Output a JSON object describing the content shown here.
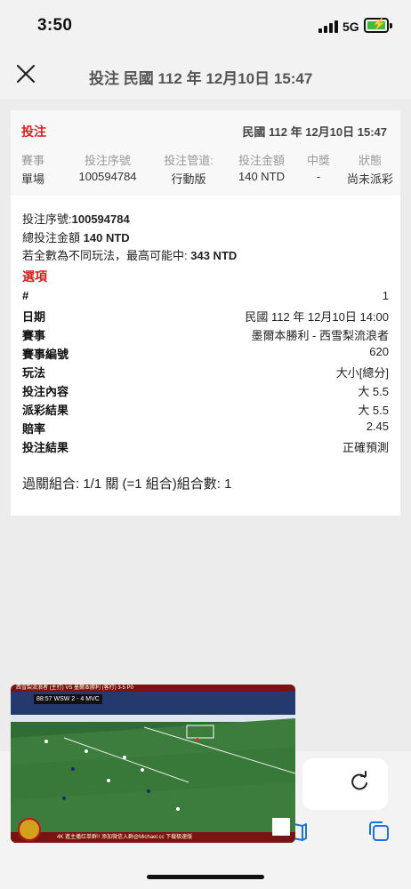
{
  "status_bar": {
    "time": "3:50",
    "network": "5G",
    "battery_charging": true
  },
  "nav": {
    "title": "投注 民國 112 年 12月10日 15:47"
  },
  "bet": {
    "title": "投注",
    "date": "民國 112 年 12月10日 15:47",
    "summary": {
      "headers": [
        "賽事",
        "投注序號",
        "投注管道:",
        "投注金額",
        "中獎",
        "狀態"
      ],
      "values": [
        "單場",
        "100594784",
        "行動版",
        "140 NTD",
        "-",
        "尚未派彩"
      ]
    },
    "serial_label": "投注序號:",
    "serial_value": "100594784",
    "total_label": "總投注金額",
    "total_value": "140 NTD",
    "max_win_label": "若全數為不同玩法，最高可能中:",
    "max_win_value": "343 NTD",
    "options_title": "選項",
    "details": [
      {
        "label": "#",
        "value": "1"
      },
      {
        "label": "日期",
        "value": "民國 112 年 12月10日 14:00"
      },
      {
        "label": "賽事",
        "value": "墨爾本勝利 - 西雪梨流浪者"
      },
      {
        "label": "賽事編號",
        "value": "620"
      },
      {
        "label": "玩法",
        "value": "大小[總分]"
      },
      {
        "label": "投注內容",
        "value": "大 5.5"
      },
      {
        "label": "派彩結果",
        "value": "大 5.5"
      },
      {
        "label": "賠率",
        "value": "2.45"
      },
      {
        "label": "投注結果",
        "value": "正確預測"
      }
    ],
    "combo": "過關組合: 1/1 關 (=1 組合)組合數: 1"
  },
  "video": {
    "banner": "西雪梨流浪者 (主打) VS 墨爾本勝利 (客打) 3-5 P0",
    "score": "88:57  WSW  2 - 4  MVC",
    "bottom_text": "4K  進主播红单群!!  添加微信入群@Michael.cc 下载极速版"
  },
  "colors": {
    "accent_red": "#d32020",
    "card_bg": "#ffffff",
    "page_bg": "#ececec",
    "browser_blue": "#1a73e8"
  },
  "icons": [
    "close-icon",
    "signal-icon",
    "battery-icon",
    "reload-icon",
    "bookmarks-icon",
    "tabs-icon"
  ]
}
